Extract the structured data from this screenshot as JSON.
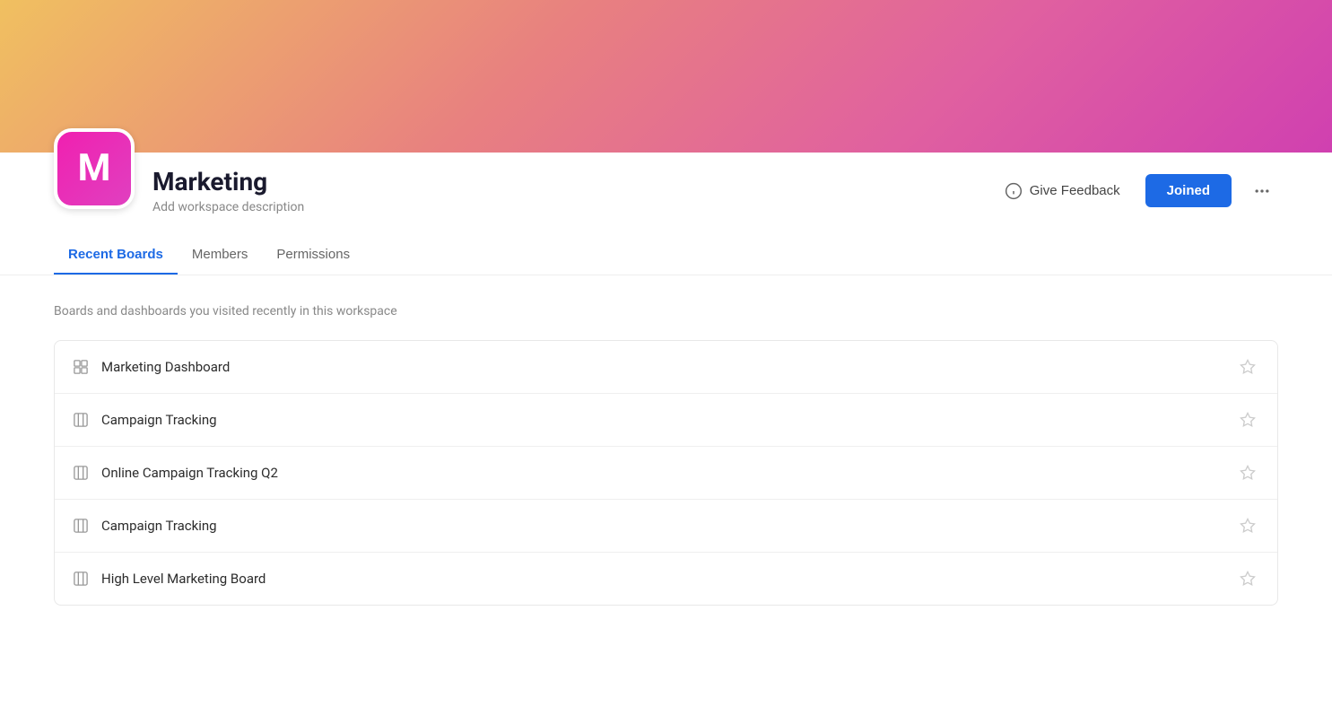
{
  "header": {
    "banner_gradient": "linear-gradient(135deg, #f0c060 0%, #e88080 40%, #e060a0 70%, #d040b0 100%)",
    "logo_letter": "M",
    "workspace_name": "Marketing",
    "workspace_desc": "Add workspace description",
    "give_feedback_label": "Give Feedback",
    "joined_label": "Joined",
    "more_icon": "···"
  },
  "tabs": [
    {
      "id": "recent-boards",
      "label": "Recent Boards",
      "active": true
    },
    {
      "id": "members",
      "label": "Members",
      "active": false
    },
    {
      "id": "permissions",
      "label": "Permissions",
      "active": false
    }
  ],
  "recent_boards": {
    "section_desc": "Boards and dashboards you visited recently in this workspace",
    "items": [
      {
        "id": 1,
        "name": "Marketing Dashboard",
        "type": "dashboard"
      },
      {
        "id": 2,
        "name": "Campaign Tracking",
        "type": "board"
      },
      {
        "id": 3,
        "name": "Online Campaign Tracking Q2",
        "type": "board"
      },
      {
        "id": 4,
        "name": "Campaign Tracking",
        "type": "board"
      },
      {
        "id": 5,
        "name": "High Level Marketing Board",
        "type": "board"
      }
    ]
  }
}
